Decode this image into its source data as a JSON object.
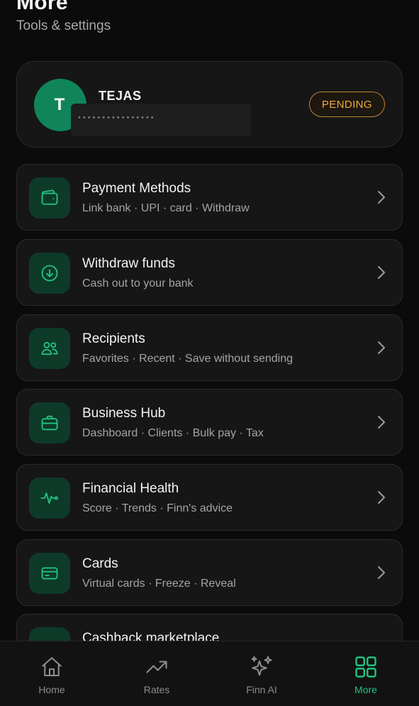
{
  "header": {
    "title": "More",
    "subtitle": "Tools & settings"
  },
  "profile": {
    "initial": "T",
    "name": "TEJAS",
    "masked_id": "••••••••••••••••",
    "status": "PENDING",
    "colors": {
      "avatar": "#10855a",
      "status": "#f0a93d"
    }
  },
  "menu": [
    {
      "title": "Payment Methods",
      "subtitle": "Link bank · UPI · card · Withdraw",
      "icon": "wallet-icon"
    },
    {
      "title": "Withdraw funds",
      "subtitle": "Cash out to your bank",
      "icon": "arrow-down-circle-icon"
    },
    {
      "title": "Recipients",
      "subtitle": "Favorites · Recent · Save without sending",
      "icon": "users-icon"
    },
    {
      "title": "Business Hub",
      "subtitle": "Dashboard · Clients · Bulk pay · Tax",
      "icon": "briefcase-icon"
    },
    {
      "title": "Financial Health",
      "subtitle": "Score · Trends · Finn's advice",
      "icon": "pulse-icon"
    },
    {
      "title": "Cards",
      "subtitle": "Virtual cards · Freeze · Reveal",
      "icon": "credit-card-icon"
    },
    {
      "title": "Cashback marketplace",
      "subtitle": "",
      "icon": "gift-icon"
    }
  ],
  "nav": [
    {
      "label": "Home",
      "icon": "home-icon"
    },
    {
      "label": "Rates",
      "icon": "trend-up-icon"
    },
    {
      "label": "Finn AI",
      "icon": "sparkles-icon"
    },
    {
      "label": "More",
      "icon": "grid-icon",
      "active": true
    }
  ],
  "colors": {
    "accent": "#22c37e",
    "background": "#0b0b0b",
    "card": "#161616",
    "icon_tile": "#0e3a2a"
  }
}
